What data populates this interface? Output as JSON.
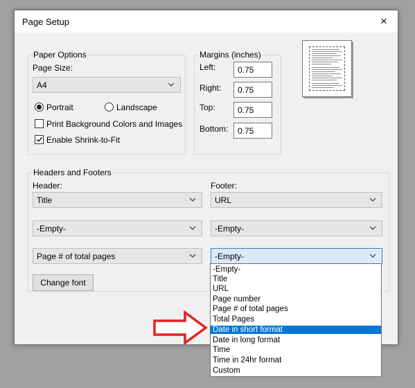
{
  "dialog": {
    "title": "Page Setup",
    "close_glyph": "×"
  },
  "paper": {
    "group_title": "Paper Options",
    "page_size_label": "Page Size:",
    "page_size_value": "A4",
    "portrait_label": "Portrait",
    "landscape_label": "Landscape",
    "orientation": "Portrait",
    "print_bg_label": "Print Background Colors and Images",
    "print_bg_checked": false,
    "shrink_label": "Enable Shrink-to-Fit",
    "shrink_checked": true
  },
  "margins": {
    "group_title": "Margins (inches)",
    "left_label": "Left:",
    "left_value": "0.75",
    "right_label": "Right:",
    "right_value": "0.75",
    "top_label": "Top:",
    "top_value": "0.75",
    "bottom_label": "Bottom:",
    "bottom_value": "0.75"
  },
  "headers_footers": {
    "group_title": "Headers and Footers",
    "header_label": "Header:",
    "footer_label": "Footer:",
    "header": [
      "Title",
      "-Empty-",
      "Page # of total pages"
    ],
    "footer": [
      "URL",
      "-Empty-",
      "-Empty-"
    ],
    "change_font_label": "Change font"
  },
  "dropdown": {
    "options": [
      "-Empty-",
      "Title",
      "URL",
      "Page number",
      "Page # of total pages",
      "Total Pages",
      "Date in short format",
      "Date in long format",
      "Time",
      "Time in 24hr format",
      "Custom"
    ],
    "highlighted": "Date in short format"
  },
  "colors": {
    "highlight": "#0078d7",
    "arrow": "#e5201f"
  },
  "icons": {
    "close": "close-icon",
    "chevron": "chevron-down-icon",
    "checkmark": "checkmark-icon",
    "arrow": "red-right-arrow-icon",
    "preview": "page-preview-thumbnail"
  }
}
